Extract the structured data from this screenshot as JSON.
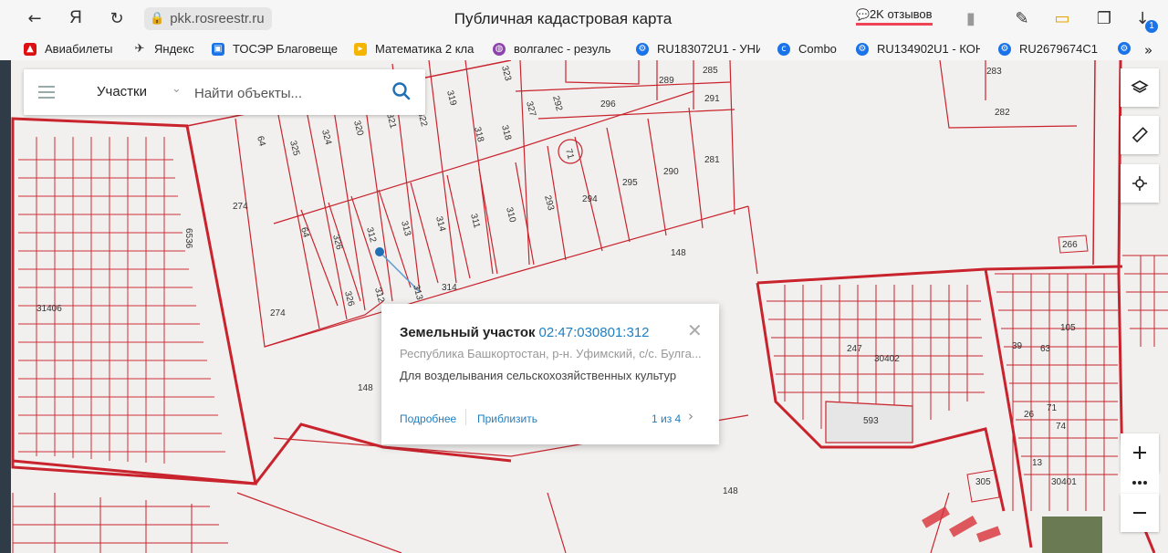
{
  "browser": {
    "url": "pkk.rosreestr.ru",
    "title": "Публичная кадастровая карта",
    "reviews": "2K отзывов",
    "download_badge": "1"
  },
  "bookmarks": [
    {
      "label": "Авиабилеты",
      "color": "#d11"
    },
    {
      "label": "Яндекс",
      "color": "#333"
    },
    {
      "label": "ТОСЭР Благовеще",
      "color": "#1a73e8"
    },
    {
      "label": "Математика 2 кла",
      "color": "#f5b400"
    },
    {
      "label": "волгалес - резуль",
      "color": "#8e44ad"
    },
    {
      "label": "RU183072U1 - УНИ",
      "color": "#1a73e8"
    },
    {
      "label": "Combo",
      "color": "#1a73e8"
    },
    {
      "label": "RU134902U1 - КОН",
      "color": "#1a73e8"
    },
    {
      "label": "RU2679674C1",
      "color": "#1a73e8"
    }
  ],
  "search": {
    "category": "Участки",
    "placeholder": "Найти объекты..."
  },
  "popup": {
    "title": "Земельный участок",
    "cadastral_number": "02:47:030801:312",
    "address": "Республика Башкортостан, р-н. Уфимский, с/с. Булга...",
    "usage": "Для возделывания сельскохозяйственных культур",
    "more_link": "Подробнее",
    "zoom_link": "Приблизить",
    "pagination": "1 из 4"
  },
  "map_labels": {
    "l31406": "31406",
    "l6536": "6536",
    "l274a": "274",
    "l274b": "274",
    "l148a": "148",
    "l148b": "148",
    "l148c": "148",
    "l64a": "64",
    "l64b": "64",
    "l325": "325",
    "l324": "324",
    "l320": "320",
    "l321": "321",
    "l322": "322",
    "l319": "319",
    "l318a": "318",
    "l318b": "318",
    "l323": "323",
    "l327": "327",
    "l292": "292",
    "l296": "296",
    "l289": "289",
    "l285": "285",
    "l291": "291",
    "l71": "71",
    "l281": "281",
    "l290": "290",
    "l295": "295",
    "l294": "294",
    "l293": "293",
    "l310": "310",
    "l311": "311",
    "l314a": "314",
    "l314b": "314",
    "l313a": "313",
    "l313b": "313",
    "l312a": "312",
    "l312b": "312",
    "l326a": "326",
    "l326b": "326",
    "l283": "283",
    "l282": "282",
    "l266": "266",
    "l105": "105",
    "l63": "63",
    "l39": "39",
    "l30402": "30402",
    "l247": "247",
    "l593": "593",
    "l71b": "71",
    "l74": "74",
    "l26": "26",
    "l13": "13",
    "l30401": "30401",
    "l305": "305"
  },
  "icons": {
    "layers": "layers-icon",
    "ruler": "ruler-icon",
    "locate": "locate-icon",
    "zoom_in": "plus-icon",
    "more": "more-icon",
    "zoom_out": "minus-icon"
  }
}
